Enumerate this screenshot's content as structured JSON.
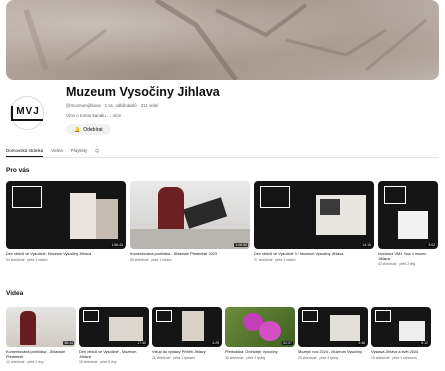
{
  "channel": {
    "name": "Muzeum Vysočiny Jihlava",
    "avatar_text": "MVJ",
    "meta": "@muzeumjihlava · 1 tis. odběratelů · 311 videí",
    "description": "Více o tomto kanálu … více",
    "subscribe_label": "Odebírat"
  },
  "tabs": [
    {
      "label": "Domovská stránka",
      "active": true
    },
    {
      "label": "Videa",
      "active": false
    },
    {
      "label": "Playlisty",
      "active": false
    },
    {
      "label": "Q",
      "active": false
    }
  ],
  "sections": {
    "for_you": "Pro vás",
    "videos": "Videa"
  },
  "for_you_videos": [
    {
      "title": "Den vědců ve Vysočině: Muzeum Vysočiny Jihlava",
      "meta": "54 zhlédnutí · před 1 rokem",
      "duration": "1:56:43"
    },
    {
      "title": "Komentovaná prohlídka - Jihlavské Předměstí 2023",
      "meta": "39 zhlédnutí · před 1 rokem",
      "duration": "1:08:58"
    },
    {
      "title": "Den vědců ve Vysočině 3 / Muzeum Vysočiny Jihlava",
      "meta": "27 zhlédnutí · před 1 rokem",
      "duration": "14:15"
    },
    {
      "title": "Nocturna VMJ. Noc v muzeu Jihlava",
      "meta": "43 zhlédnutí · před 2 lety",
      "duration": "3:02"
    }
  ],
  "videos": [
    {
      "title": "Komentovaná prohlídka - Jihlavské Předměstí",
      "meta": "12 zhlédnutí · před 2 dny",
      "duration": "38:14"
    },
    {
      "title": "Den vědců ve Vysočině - Muzeum Jihlava",
      "meta": "18 zhlédnutí · před 5 dny",
      "duration": "17:40"
    },
    {
      "title": "Vstup do výstavy Příběh Jihlavy",
      "meta": "21 zhlédnutí · před 1 týdnem",
      "duration": "4:25"
    },
    {
      "title": "Přednáška: Orchideje Vysočiny",
      "meta": "30 zhlédnutí · před 2 týdny",
      "duration": "52:07"
    },
    {
      "title": "Muzejní noc 2024 - Muzeum Vysočiny",
      "meta": "25 zhlédnutí · před 3 týdny",
      "duration": "2:46"
    },
    {
      "title": "Výstava Jihlava a svět 2024",
      "meta": "19 zhlédnutí · před 1 měsícem",
      "duration": "6:12"
    }
  ]
}
